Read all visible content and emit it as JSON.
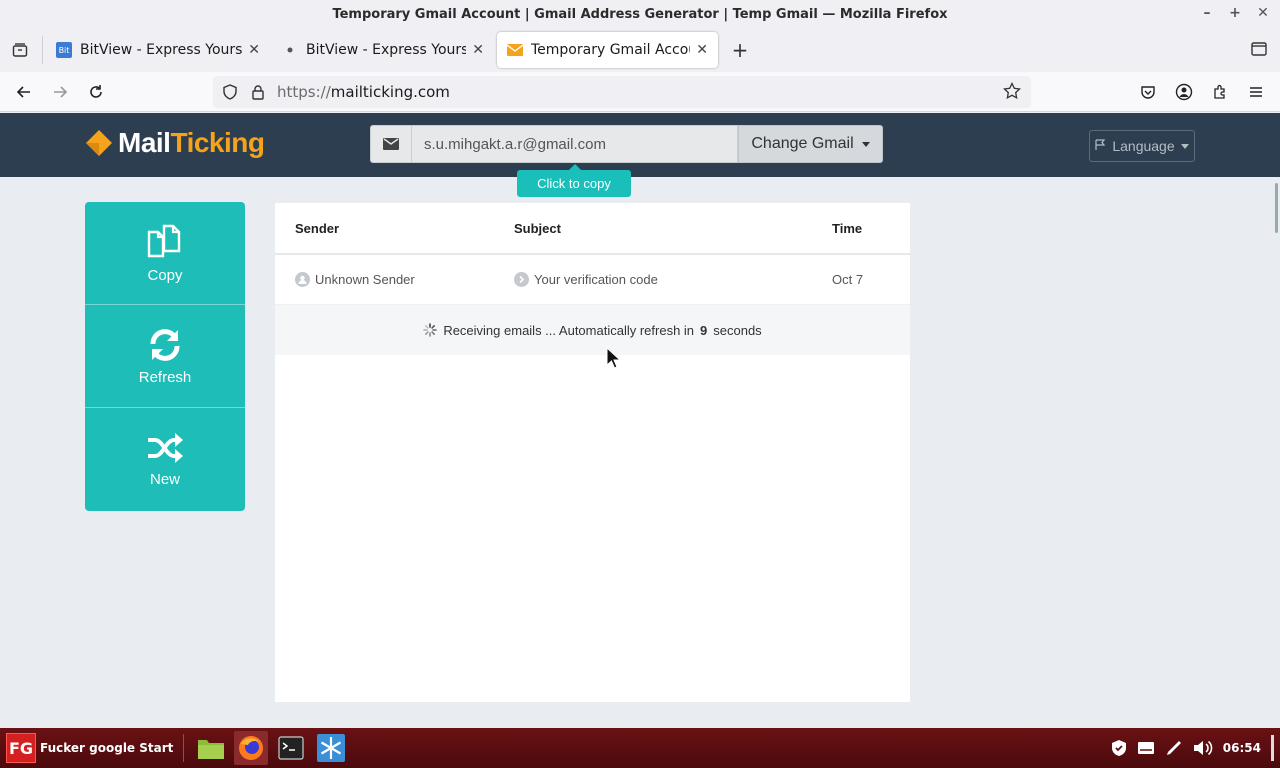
{
  "window": {
    "title": "Temporary Gmail Account | Gmail Address Generator | Temp Gmail — Mozilla Firefox",
    "controls": [
      "minimize",
      "maximize",
      "close"
    ]
  },
  "tabs": [
    {
      "label": "BitView - Express Yoursel",
      "active": false
    },
    {
      "label": "BitView - Express Yoursel",
      "active": false
    },
    {
      "label": "Temporary Gmail Accoun",
      "active": true
    }
  ],
  "navbar": {
    "url_protocol": "https://",
    "url_host": "mailticking.com"
  },
  "site": {
    "logo_mail": "Mail",
    "logo_ticking": "Ticking",
    "email_value": "s.u.mihgakt.a.r@gmail.com",
    "change_label": "Change Gmail",
    "tooltip": "Click to copy",
    "language_label": "Language",
    "brand_color": "#1ebdb8",
    "header_color": "#2d3e50"
  },
  "sidebar": [
    {
      "label": "Copy",
      "icon": "copy-icon"
    },
    {
      "label": "Refresh",
      "icon": "refresh-icon"
    },
    {
      "label": "New",
      "icon": "shuffle-icon"
    }
  ],
  "inbox": {
    "columns": [
      "Sender",
      "Subject",
      "Time"
    ],
    "rows": [
      {
        "sender": "Unknown Sender",
        "subject": "Your verification code",
        "time": "Oct 7"
      }
    ],
    "status_prefix": "Receiving emails ... Automatically refresh in",
    "countdown": "9",
    "status_suffix": "seconds"
  },
  "taskbar": {
    "start_label": "Fucker google Start",
    "start_badge": "FG",
    "clock": "06:54"
  }
}
